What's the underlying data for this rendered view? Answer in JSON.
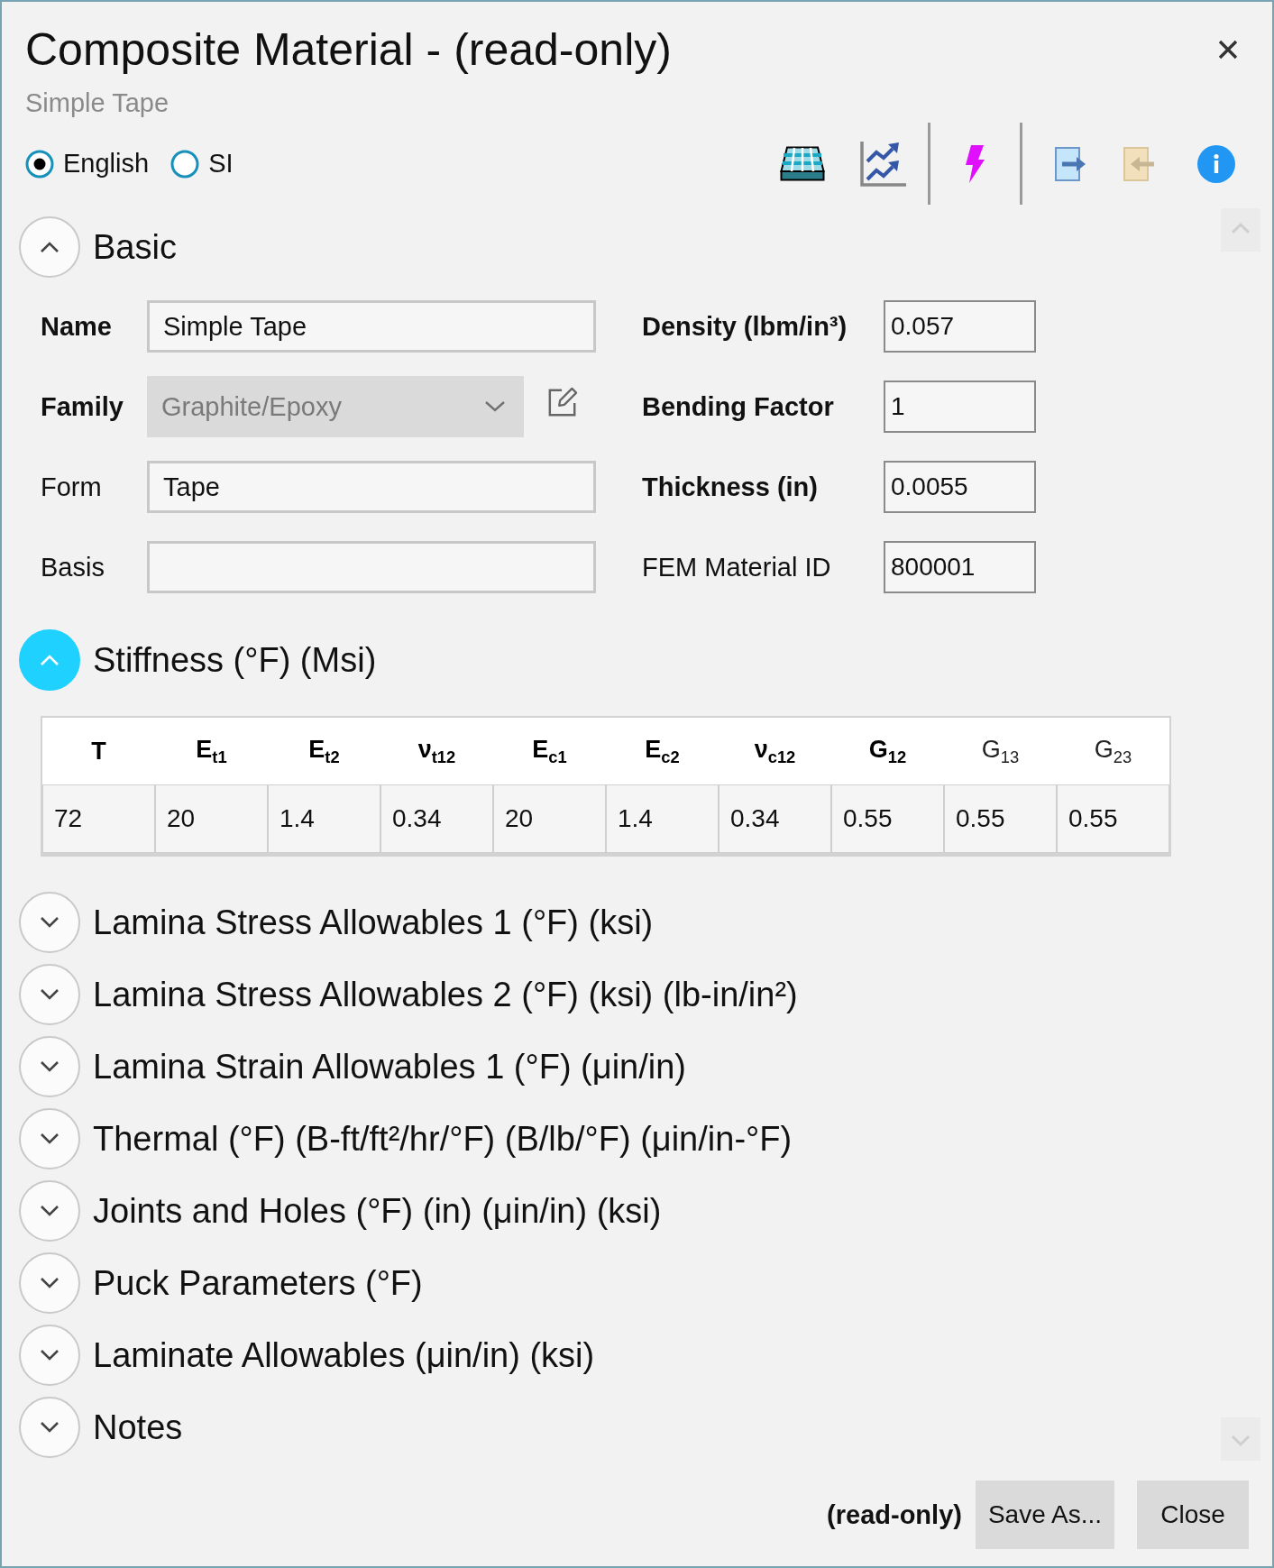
{
  "window": {
    "title": "Composite Material - (read-only)",
    "subtitle": "Simple Tape"
  },
  "units": [
    {
      "label": "English",
      "selected": true
    },
    {
      "label": "SI",
      "selected": false
    }
  ],
  "sections": [
    {
      "title": "Basic",
      "expanded": true,
      "highlighted": false,
      "fields": {
        "left": [
          {
            "label": "Name",
            "emphasized": true,
            "kind": "text",
            "value": "Simple Tape"
          },
          {
            "label": "Family",
            "emphasized": true,
            "kind": "dropdown",
            "value": "Graphite/Epoxy",
            "disabled": true
          },
          {
            "label": "Form",
            "emphasized": false,
            "kind": "text",
            "value": "Tape"
          },
          {
            "label": "Basis",
            "emphasized": false,
            "kind": "text"
          }
        ],
        "right": [
          {
            "label": "Density (lbm/in³)",
            "emphasized": true,
            "value": "0.057"
          },
          {
            "label": "Bending Factor",
            "emphasized": true,
            "value": "1"
          },
          {
            "label": "Thickness (in)",
            "emphasized": true,
            "value": "0.0055"
          },
          {
            "label": "FEM Material ID",
            "emphasized": false,
            "value": "800001"
          }
        ]
      }
    },
    {
      "title": "Stiffness (°F) (Msi)",
      "expanded": true,
      "highlighted": true,
      "table": {
        "columns": [
          {
            "label": "T",
            "emphasized": true
          },
          {
            "label": "E$_{t1}$",
            "emphasized": true
          },
          {
            "label": "E$_{t2}$",
            "emphasized": true
          },
          {
            "label": "ν$_{t12}$",
            "emphasized": true
          },
          {
            "label": "E$_{c1}$",
            "emphasized": true
          },
          {
            "label": "E$_{c2}$",
            "emphasized": true
          },
          {
            "label": "ν$_{c12}$",
            "emphasized": true
          },
          {
            "label": "G$_{12}$",
            "emphasized": true
          },
          {
            "label": "G$_{13}$",
            "emphasized": false
          },
          {
            "label": "G$_{23}$",
            "emphasized": false
          }
        ],
        "rows": [
          [
            "72",
            "20",
            "1.4",
            "0.34",
            "20",
            "1.4",
            "0.34",
            "0.55",
            "0.55",
            "0.55"
          ]
        ]
      }
    },
    {
      "title": "Lamina Stress Allowables 1 (°F) (ksi)",
      "expanded": false,
      "highlighted": false
    },
    {
      "title": "Lamina Stress Allowables 2 (°F) (ksi) (lb-in/in²)",
      "expanded": false,
      "highlighted": false
    },
    {
      "title": "Lamina Strain Allowables 1 (°F) (μin/in)",
      "expanded": false,
      "highlighted": false
    },
    {
      "title": "Thermal (°F) (B-ft/ft²/hr/°F) (B/lb/°F) (μin/in-°F)",
      "expanded": false,
      "highlighted": false
    },
    {
      "title": "Joints and Holes (°F) (in) (μin/in) (ksi)",
      "expanded": false,
      "highlighted": false
    },
    {
      "title": "Puck Parameters (°F)",
      "expanded": false,
      "highlighted": false
    },
    {
      "title": "Laminate Allowables (μin/in) (ksi)",
      "expanded": false,
      "highlighted": false
    },
    {
      "title": "Notes",
      "expanded": false,
      "highlighted": false
    }
  ],
  "footer": {
    "status": "(read-only)",
    "buttons": [
      "Save As...",
      "Close"
    ]
  }
}
